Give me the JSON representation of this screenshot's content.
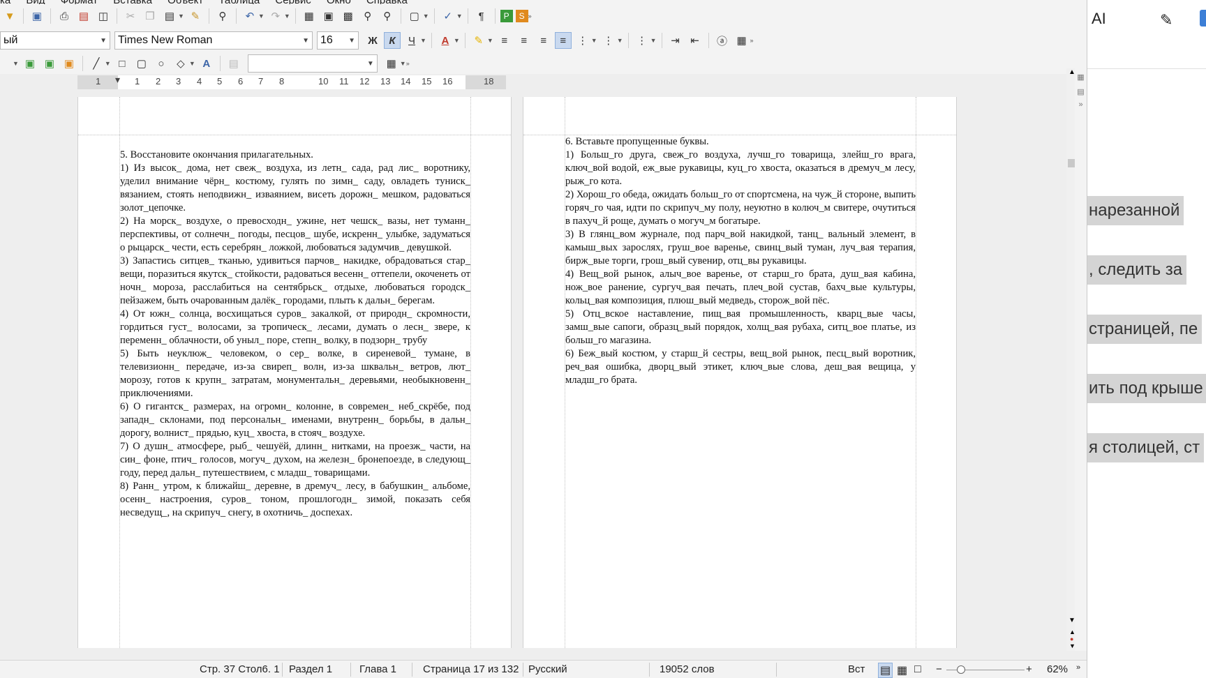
{
  "menu": [
    "ка",
    "Вид",
    "Формат",
    "Вставка",
    "Объект",
    "Таблица",
    "Сервис",
    "Окно",
    "Справка"
  ],
  "formatting": {
    "style": "ый",
    "font": "Times New Roman",
    "size": "16",
    "bold": "Ж",
    "italic": "К",
    "underline": "Ч"
  },
  "ruler_ticks": [
    "1",
    "1",
    "1",
    "2",
    "3",
    "4",
    "5",
    "6",
    "7",
    "8",
    "10",
    "11",
    "12",
    "13",
    "14",
    "15",
    "16",
    "18"
  ],
  "page_left": {
    "heading": "5. Восстановите окончания прилагательных.",
    "paragraphs": [
      "1) Из высок_ дома, нет свеж_ воздуха, из летн_ сада, рад лис_ воротнику, уделил внимание чёрн_ костюму, гулять по зимн_ саду, овладеть туниск_ вязанием, стоять неподвижн_ изваянием, висеть дорожн_ мешком, радоваться золот_цепочке.",
      "2) На морск_ воздухе, о превосходн_ ужине, нет чешск_ вазы, нет туманн_ перспективы, от солнечн_ погоды, песцов_ шубе, искренн_ улыбке, задуматься о рыцарск_ чести, есть серебрян_ ложкой, любоваться задумчив_ девушкой.",
      "3) Запастись ситцев_ тканью, удивиться парчов_ накидке, обрадоваться стар_ вещи, поразиться якутск_ стойкости, радоваться весенн_ оттепели, окоченеть от ночн_ мороза, расслабиться на сентябрьск_ отдыхе, любоваться городск_ пейзажем, быть очарованным далёк_ городами, плыть к дальн_ берегам.",
      "4) От южн_ солнца, восхищаться суров_ закалкой, от природн_ скромности, гордиться густ_ волосами, за тропическ_ лесами, думать о лесн_ звере, к переменн_ облачности, об уныл_ поре, степн_ волку, в подзорн_ трубу",
      "5) Быть неуклюж_ человеком, о сер_ волке, в сиреневой_ тумане, в телевизионн_ передаче, из-за свиреп_ волн, из-за шквальн_ ветров, лют_ морозу, готов к крупн_ затратам, монументальн_ деревьями, необыкновенн_ приключениями.",
      "6) О гигантск_ размерах, на огромн_ колонне, в современ_ неб_скрёбе, под западн_ склонами, под персональн_ именами, внутренн_ борьбы, в дальн_ дорогу, волнист_ прядью, куц_ хвоста, в стояч_ воздухе.",
      "7) О душн_ атмосфере, рыб_ чешуёй, длинн_ нитками, на проезж_ части, на син_ фоне, птич_ голосов, могуч_ духом, на железн_ бронепоезде, в следующ_ году, перед дальн_ путешествием, с младш_ товарищами.",
      "8) Ранн_ утром, к ближайш_ деревне, в дремуч_ лесу, в бабушкин_ альбоме, осенн_ настроения, суров_ тоном, прошлогодн_ зимой, показать себя несведущ_, на скрипуч_ снегу, в охотничь_ доспехах."
    ]
  },
  "page_right": {
    "heading": "6. Вставьте пропущенные буквы.",
    "paragraphs": [
      "1) Больш_го друга, свеж_го воздуха, лучш_го товарища, злейш_го врага, ключ_вой водой, еж_вые рукавицы, куц_го хвоста, оказаться в дремуч_м лесу, рыж_го кота.",
      "2) Хорош_го обеда, ожидать больш_го от спортсмена, на чуж_й стороне, выпить горяч_го чая, идти по скрипуч_му полу, неуютно в колюч_м свитере, очутиться в пахуч_й роще, думать о могуч_м богатыре.",
      "3) В глянц_вом журнале, под парч_вой накидкой, танц_ вальный элемент, в камыш_вых зарослях, груш_вое варенье, свинц_вый туман, луч_вая терапия, бирж_вые торги, грош_вый сувенир, отц_вы рукавицы.",
      "4) Вещ_вой рынок, алыч_вое варенье, от старш_го брата, душ_вая кабина, нож_вое ранение, сургуч_вая печать, плеч_вой сустав, бахч_вые культуры, кольц_вая композиция, плюш_вый медведь, сторож_вой пёс.",
      "5) Отц_вское наставление, пищ_вая промышленность, кварц_вые часы, замш_вые сапоги, образц_вый порядок, холщ_вая рубаха, ситц_вое платье, из больш_го магазина.",
      "6) Беж_вый костюм, у старш_й сестры, вещ_вой рынок, песц_вый воротник, реч_вая ошибка, дворц_вый этикет, ключ_вые слова, деш_вая вещица, у младш_го брата."
    ]
  },
  "status": {
    "position": "Стр. 37 Стол6. 1",
    "section": "Раздел 1",
    "chapter": "Глава 1",
    "page": "Страница 17 из 132",
    "language": "Русский",
    "words": "19052 слов",
    "mode": "Вст",
    "zoom": "62%"
  },
  "right_panel": {
    "ai_label": "AI",
    "lines": [
      {
        "text": "нарезанной"
      },
      {
        "text": ", следить за"
      },
      {
        "text": "страницей, пе"
      },
      {
        "text": "ить под крыше"
      },
      {
        "text": "я столицей, ст"
      }
    ]
  },
  "icons": [
    "open-icon",
    "save-icon",
    "print-icon",
    "pdf-icon",
    "undo-icon",
    "redo-icon",
    "find-icon",
    "spellcheck-icon",
    "pilcrow-icon",
    "align-left-icon",
    "align-center-icon",
    "align-right-icon",
    "justify-icon"
  ]
}
